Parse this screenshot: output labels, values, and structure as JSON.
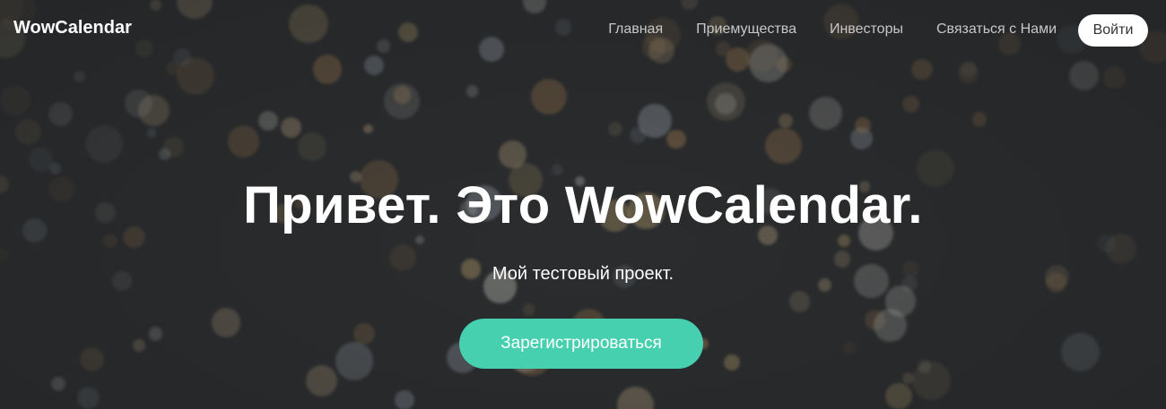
{
  "brand": {
    "name": "WowCalendar"
  },
  "nav": {
    "items": [
      {
        "label": "Главная"
      },
      {
        "label": "Приемущества"
      },
      {
        "label": "Инвесторы"
      },
      {
        "label": "Связаться с Нами"
      }
    ],
    "login_label": "Войти"
  },
  "hero": {
    "title": "Привет. Это WowCalendar.",
    "subtitle": "Мой тестовый проект.",
    "cta_label": "Зарегистрироваться"
  },
  "colors": {
    "accent": "#46d0b0",
    "background": "#2b2d2f",
    "text": "#ffffff"
  }
}
